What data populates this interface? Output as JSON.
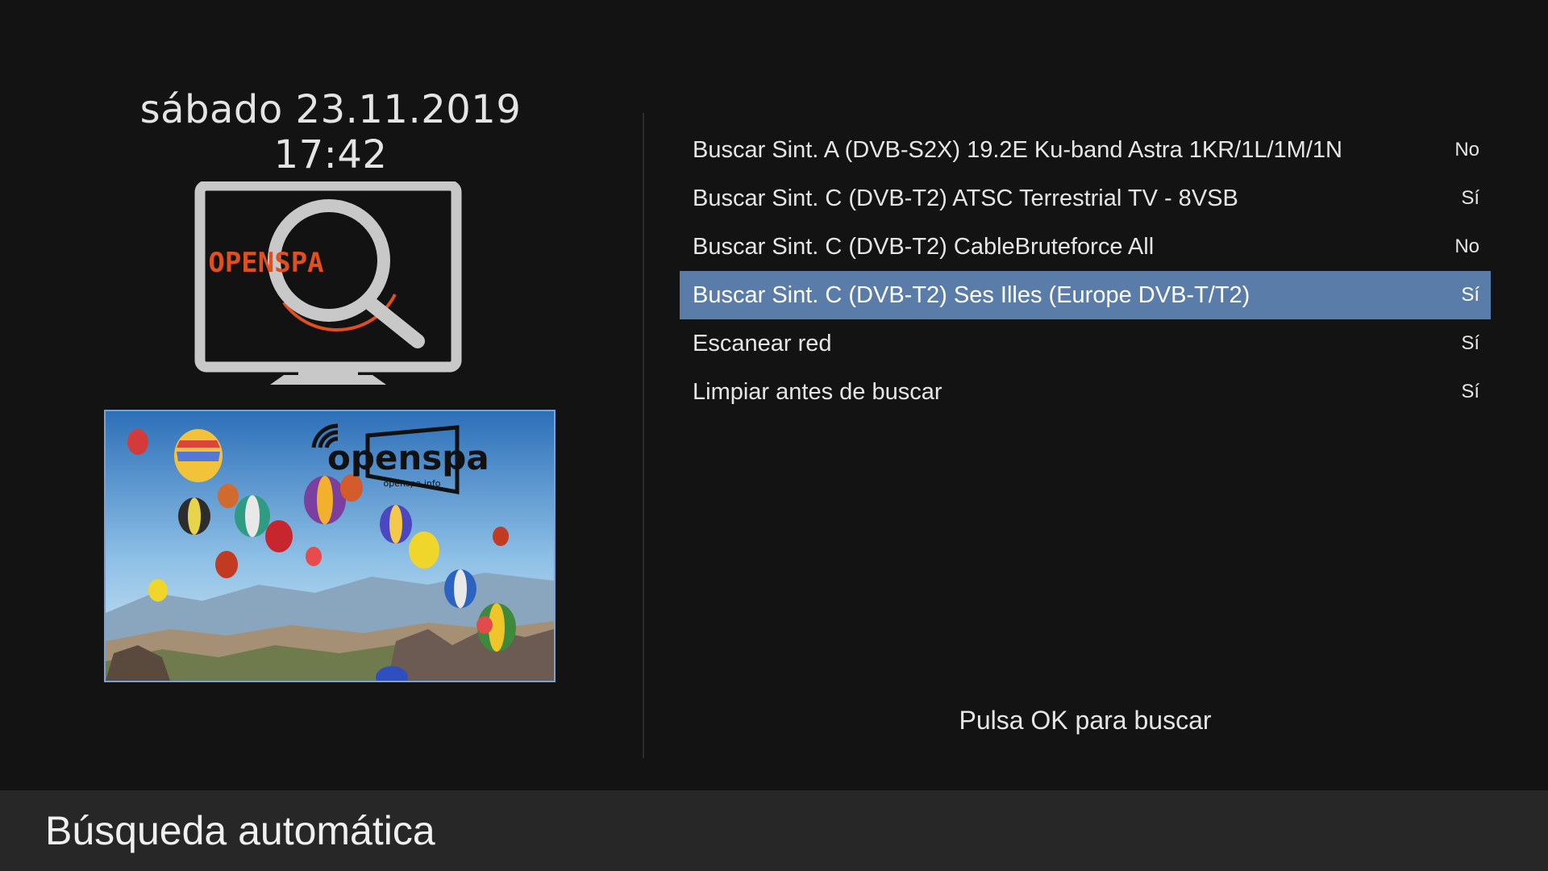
{
  "datetime": "sábado 23.11.2019 17:42",
  "logo": {
    "text": "OPENSPA",
    "icon": "tv-search-icon",
    "brand_color": "#e04f1f"
  },
  "preview": {
    "brand": "openspa",
    "site": "openspa.info"
  },
  "menu": {
    "items": [
      {
        "label": "Buscar Sint. A (DVB-S2X) 19.2E Ku-band Astra 1KR/1L/1M/1N",
        "value": "No",
        "selected": false
      },
      {
        "label": "Buscar Sint. C (DVB-T2) ATSC Terrestrial TV - 8VSB",
        "value": "Sí",
        "selected": false
      },
      {
        "label": "Buscar Sint. C (DVB-T2) CableBruteforce All",
        "value": "No",
        "selected": false
      },
      {
        "label": "Buscar Sint. C (DVB-T2) Ses Illes (Europe DVB-T/T2)",
        "value": "Sí",
        "selected": true
      },
      {
        "label": "Escanear red",
        "value": "Sí",
        "selected": false
      },
      {
        "label": "Limpiar antes de buscar",
        "value": "Sí",
        "selected": false
      }
    ],
    "selected_color": "#5a7ca8"
  },
  "hint": "Pulsa OK para buscar",
  "footer": {
    "title": "Búsqueda automática"
  }
}
